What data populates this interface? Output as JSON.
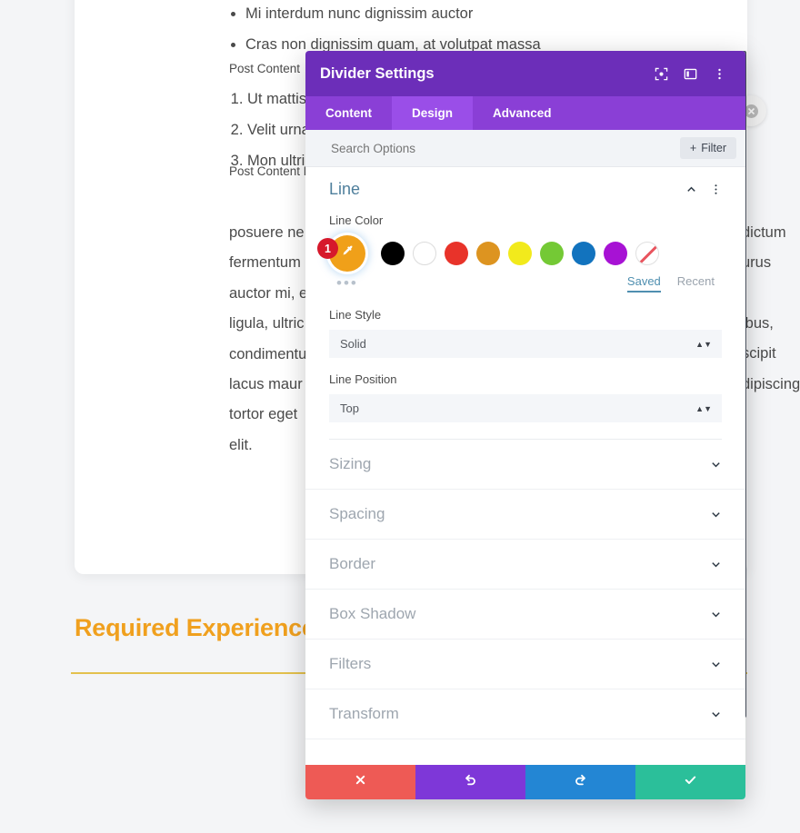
{
  "background": {
    "bullets": [
      "Mi interdum nunc dignissim auctor",
      "Cras non dignissim quam, at volutpat massa"
    ],
    "heading_1": "Post Content",
    "numbered": [
      "Ut mattis",
      "Velit urna",
      "Mon ultric"
    ],
    "heading_2": "Post Content H",
    "paragraph_left": [
      "posuere ne",
      "fermentum",
      "auctor mi, e",
      "ligula, ultric",
      "condimentu",
      "lacus maur",
      "tortor eget",
      "elit."
    ],
    "paragraph_right": [
      "dictum",
      "urus",
      "ibus,",
      "scipit",
      "dipiscing"
    ],
    "required_heading": "Required Experience",
    "close_icon": "close-circle-icon"
  },
  "modal": {
    "title": "Divider Settings",
    "header_icons": [
      {
        "name": "fullscreen-icon"
      },
      {
        "name": "layout-split-icon"
      },
      {
        "name": "kebab-menu-icon"
      }
    ],
    "tabs": [
      {
        "label": "Content",
        "active": false
      },
      {
        "label": "Design",
        "active": true
      },
      {
        "label": "Advanced",
        "active": false
      }
    ],
    "search": {
      "placeholder": "Search Options",
      "value": "",
      "filter_label": "Filter",
      "filter_icon": "plus-icon"
    },
    "line_section": {
      "title": "Line",
      "collapse_icon": "chevron-up-icon",
      "menu_icon": "kebab-menu-icon",
      "color_label": "Line Color",
      "selected_color": "#f0a019",
      "selected_icon": "eyedropper-icon",
      "selected_badge": "1",
      "palette": [
        {
          "name": "swatch-black",
          "hex": "#000000"
        },
        {
          "name": "swatch-white",
          "hex": "#ffffff"
        },
        {
          "name": "swatch-red",
          "hex": "#e8332a"
        },
        {
          "name": "swatch-orange",
          "hex": "#dd9420"
        },
        {
          "name": "swatch-yellow",
          "hex": "#f2ea1c"
        },
        {
          "name": "swatch-green",
          "hex": "#74c935"
        },
        {
          "name": "swatch-blue",
          "hex": "#1273be"
        },
        {
          "name": "swatch-purple",
          "hex": "#a712d4"
        }
      ],
      "no_color_swatch": "swatch-none",
      "more_colors_icon": "more-dots-icon",
      "saved_label": "Saved",
      "recent_label": "Recent",
      "style_label": "Line Style",
      "style_value": "Solid",
      "position_label": "Line Position",
      "position_value": "Top"
    },
    "sections": [
      {
        "label": "Sizing"
      },
      {
        "label": "Spacing"
      },
      {
        "label": "Border"
      },
      {
        "label": "Box Shadow"
      },
      {
        "label": "Filters"
      },
      {
        "label": "Transform"
      }
    ],
    "footer": [
      {
        "name": "cancel-button",
        "icon": "close-icon",
        "color": "#ee5a55"
      },
      {
        "name": "undo-button",
        "icon": "undo-icon",
        "color": "#7e37d8"
      },
      {
        "name": "redo-button",
        "icon": "redo-icon",
        "color": "#2386d4"
      },
      {
        "name": "save-button",
        "icon": "check-icon",
        "color": "#2bbf9a"
      }
    ]
  }
}
